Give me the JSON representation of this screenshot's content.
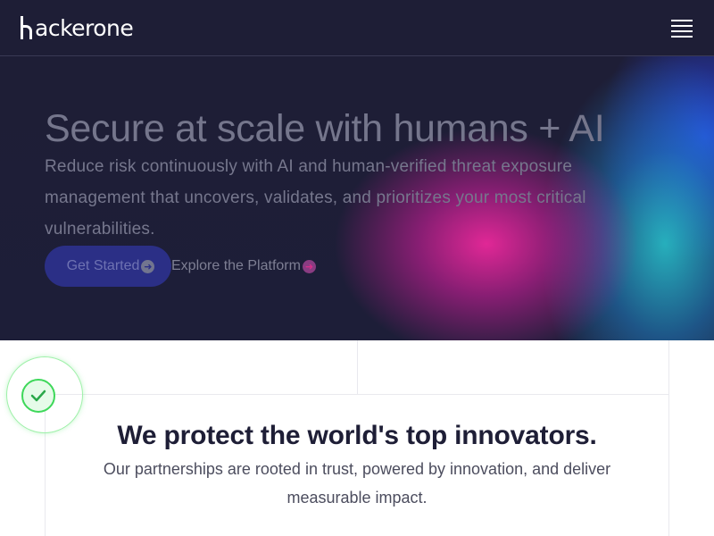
{
  "header": {
    "logo_text": "ackerone",
    "logo_alt": "hackerone",
    "menu_label": "Menu"
  },
  "hero": {
    "title": "Secure at scale with humans + AI",
    "subtitle": "Reduce risk continuously with AI and human-verified threat exposure management that uncovers, validates, and prioritizes your most critical vulnerabilities.",
    "primary_button": "Get Started",
    "secondary_link": "Explore the Platform",
    "arrow_glyph": "➜"
  },
  "section": {
    "title": "We protect the world's top innovators.",
    "subtitle": "Our partnerships are rooted in trust, powered by innovation, and deliver measurable impact."
  },
  "colors": {
    "header_bg": "#1e1e36",
    "primary_button_bg": "#2b2f86",
    "check_green": "#3ed85a",
    "hero_magenta": "#eb289b",
    "hero_cyan": "#28c8d2",
    "hero_blue": "#2846e6"
  },
  "icons": [
    "hackerone-logo-icon",
    "menu-icon",
    "arrow-circle-icon",
    "check-circle-icon"
  ]
}
